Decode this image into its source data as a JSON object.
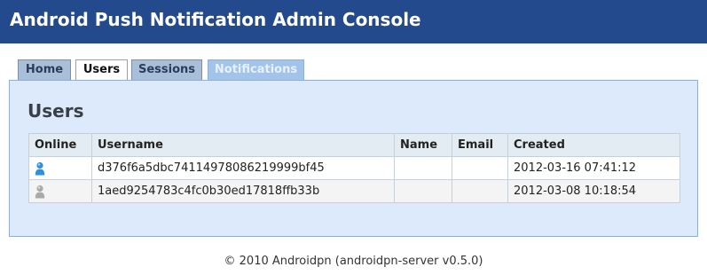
{
  "header": {
    "title": "Android Push Notification Admin Console"
  },
  "tabs": [
    {
      "label": "Home"
    },
    {
      "label": "Users",
      "active": true
    },
    {
      "label": "Sessions"
    },
    {
      "label": "Notifications"
    }
  ],
  "page": {
    "title": "Users"
  },
  "table": {
    "columns": [
      "Online",
      "Username",
      "Name",
      "Email",
      "Created"
    ],
    "rows": [
      {
        "online": true,
        "online_icon": "user-online-icon",
        "username": "d376f6a5dbc74114978086219999bf45",
        "name": "",
        "email": "",
        "created": "2012-03-16 07:41:12"
      },
      {
        "online": false,
        "online_icon": "user-offline-icon",
        "username": "1aed9254783c4fc0b30ed17818ffb33b",
        "name": "",
        "email": "",
        "created": "2012-03-08 10:18:54"
      }
    ]
  },
  "footer": {
    "text": "© 2010 Androidpn (androidpn-server v0.5.0)"
  },
  "colors": {
    "header_bg": "#234a8c",
    "panel_bg": "#ddeafb",
    "online_icon": "#2f8fe0",
    "offline_icon": "#a9a9a9"
  }
}
